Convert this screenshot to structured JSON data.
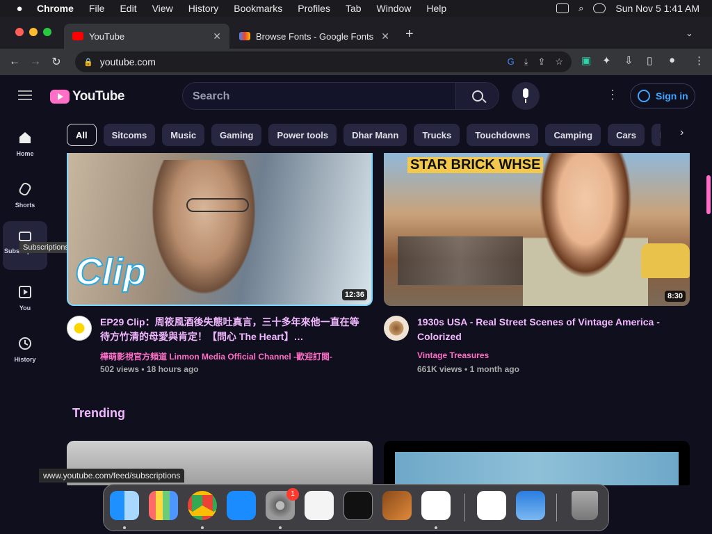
{
  "menubar": {
    "app": "Chrome",
    "items": [
      "File",
      "Edit",
      "View",
      "History",
      "Bookmarks",
      "Profiles",
      "Tab",
      "Window",
      "Help"
    ],
    "clock": "Sun Nov 5  1:41 AM"
  },
  "tabs": [
    {
      "title": "YouTube",
      "active": true
    },
    {
      "title": "Browse Fonts - Google Fonts",
      "active": false
    }
  ],
  "address": {
    "url": "youtube.com"
  },
  "youtube": {
    "logo": "YouTube",
    "search_placeholder": "Search",
    "signin": "Sign in",
    "chips": [
      "All",
      "Sitcoms",
      "Music",
      "Gaming",
      "Power tools",
      "Dhar Mann",
      "Trucks",
      "Touchdowns",
      "Camping",
      "Cars",
      "Pop"
    ],
    "sidebar": [
      {
        "label": "Home"
      },
      {
        "label": "Shorts"
      },
      {
        "label": "Subscriptions"
      },
      {
        "label": "You"
      },
      {
        "label": "History"
      }
    ],
    "tooltip": "Subscriptions",
    "videos": [
      {
        "title": "EP29 Clip：周筱風酒後失態吐真言，三十多年來他一直在等待方竹清的母愛與肯定！【問心 The Heart】…",
        "channel": "樺萌影視官方頻道 Linmon Media Official Channel -歡迎訂閱-",
        "meta": "502 views • 18 hours ago",
        "duration": "12:36",
        "overlay_text": "Clip"
      },
      {
        "title": "1930s USA - Real Street Scenes of Vintage America - Colorized",
        "channel": "Vintage Treasures",
        "meta": "661K views • 1 month ago",
        "duration": "8:30",
        "sign_text": "STAR BRICK WHSE"
      }
    ],
    "trending": "Trending"
  },
  "status_url": "www.youtube.com/feed/subscriptions",
  "dock_badge": "1",
  "colors": {
    "page_bg": "#0f0f1e",
    "accent_pink": "#ff6ec7",
    "title_pink": "#f2b8ff",
    "link_blue": "#3ea6ff"
  }
}
